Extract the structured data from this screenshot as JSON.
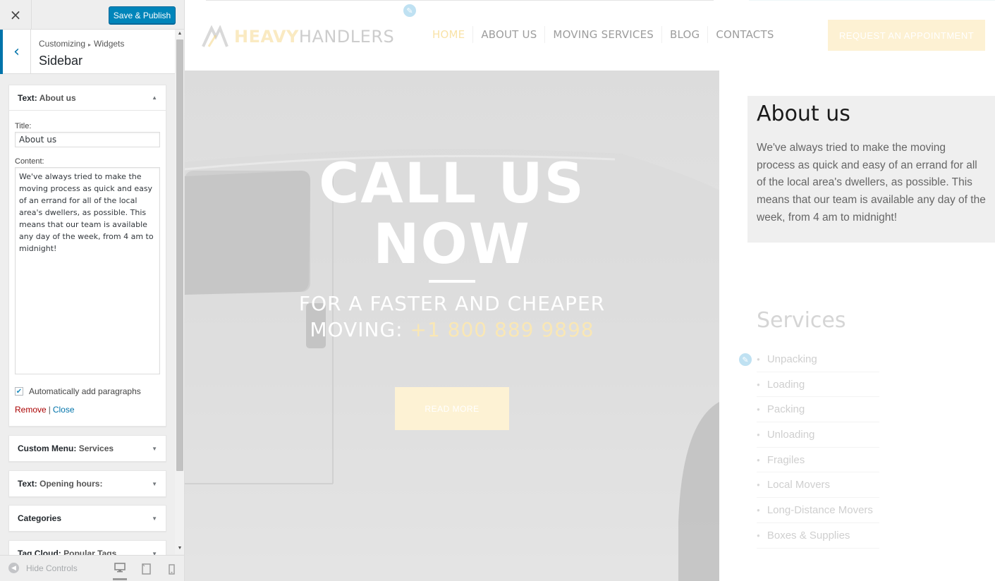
{
  "customizer": {
    "close_label": "×",
    "save_label": "Save & Publish",
    "breadcrumb": {
      "root": "Customizing",
      "separator": "▸",
      "current": "Widgets"
    },
    "section_title": "Sidebar",
    "widgets": [
      {
        "type": "Text",
        "name": "About us",
        "expanded": true
      },
      {
        "type": "Custom Menu",
        "name": "Services",
        "expanded": false
      },
      {
        "type": "Text",
        "name": "Opening hours:",
        "expanded": false
      },
      {
        "type": "Categories",
        "name": "",
        "expanded": false
      },
      {
        "type": "Tag Cloud",
        "name": "Popular Tags",
        "expanded": false
      }
    ],
    "form": {
      "title_label": "Title:",
      "title_value": "About us",
      "content_label": "Content:",
      "content_value": "We've always tried to make the moving process as quick and easy of an errand for all of the local area's dwellers, as possible. This means that our team is available any day of the week, from 4 am to midnight!",
      "auto_paragraphs_label": "Automatically add paragraphs",
      "auto_paragraphs_checked": true,
      "remove_label": "Remove",
      "separator": "|",
      "close_label": "Close"
    },
    "footer": {
      "hide_controls_label": "Hide Controls",
      "devices": [
        "desktop",
        "tablet",
        "mobile"
      ],
      "active_device": "desktop"
    }
  },
  "site": {
    "logo": {
      "heavy": "HEAVY",
      "handlers": "HANDLERS"
    },
    "nav": [
      "HOME",
      "ABOUT US",
      "MOVING SERVICES",
      "BLOG",
      "CONTACTS"
    ],
    "active_nav": "HOME",
    "cta_label": "REQUEST AN APPOINTMENT",
    "hero": {
      "title_line1": "CALL US",
      "title_line2": "NOW",
      "subtitle": "FOR A FASTER AND CHEAPER MOVING:",
      "phone": "+1 800 889 9898",
      "button_label": "READ MORE"
    },
    "sidebar": {
      "about_title": "About us",
      "about_text": "We've always tried to make the moving process as quick and easy of an errand for all of the local area's dwellers, as possible. This means that our team is available any day of the week, from 4 am to midnight!",
      "services_title": "Services",
      "services": [
        "Unpacking",
        "Loading",
        "Packing",
        "Unloading",
        "Fragiles",
        "Local Movers",
        "Long-Distance Movers",
        "Boxes & Supplies"
      ]
    }
  },
  "colors": {
    "primary": "#0085ba",
    "link": "#0073aa",
    "remove": "#aa0000",
    "accent_yellow": "#f4d27a"
  }
}
